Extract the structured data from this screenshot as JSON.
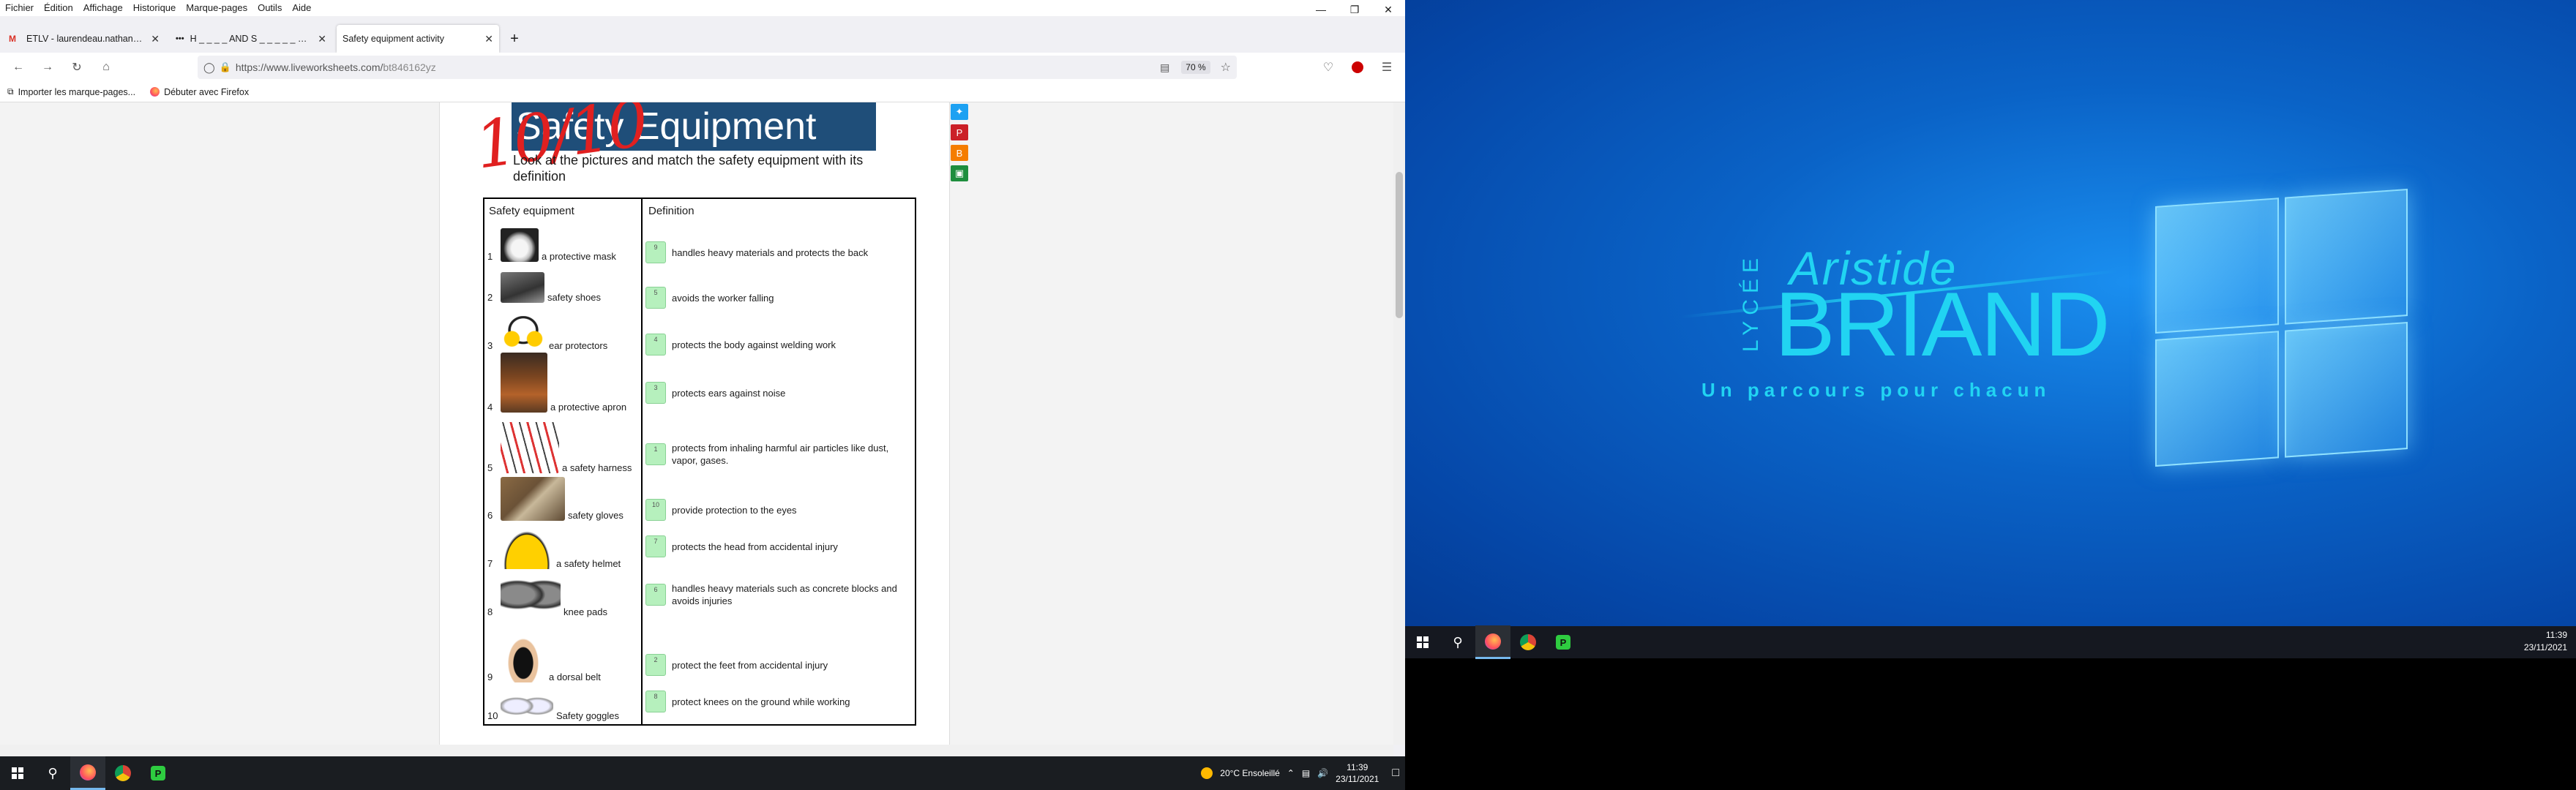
{
  "menubar": {
    "items": [
      "Fichier",
      "Édition",
      "Affichage",
      "Historique",
      "Marque-pages",
      "Outils",
      "Aide"
    ]
  },
  "tabs": [
    {
      "title": "ETLV - laurendeau.nathan@gm",
      "icon": "gmail-icon"
    },
    {
      "title": "H _ _ _ _ AND S _ _ _ _ _ _ | Ma",
      "icon": "dots-icon"
    },
    {
      "title": "Safety equipment activity",
      "icon": "",
      "active": true
    }
  ],
  "nav": {
    "url": "https://www.liveworksheets.com/bt846162yz",
    "url_host": "https://www.liveworksheets.com/",
    "url_path": "bt846162yz",
    "zoom": "70 %"
  },
  "bookmarks": [
    {
      "label": "Importer les marque-pages..."
    },
    {
      "label": "Débuter avec Firefox"
    }
  ],
  "worksheet": {
    "title": "Safety Equipment",
    "score": "10/10",
    "instructions": "Look at the pictures and match the safety equipment with its definition",
    "col1": "Safety equipment",
    "col2": "Definition",
    "items": [
      {
        "num": "1",
        "label": "a protective mask"
      },
      {
        "num": "2",
        "label": "safety shoes"
      },
      {
        "num": "3",
        "label": "ear protectors"
      },
      {
        "num": "4",
        "label": "a protective apron"
      },
      {
        "num": "5",
        "label": "a safety harness"
      },
      {
        "num": "6",
        "label": "safety gloves"
      },
      {
        "num": "7",
        "label": "a safety helmet"
      },
      {
        "num": "8",
        "label": "knee pads"
      },
      {
        "num": "9",
        "label": "a dorsal belt"
      },
      {
        "num": "10",
        "label": "Safety goggles"
      }
    ],
    "definitions": [
      {
        "answer": "9",
        "text": "handles heavy materials and protects the back"
      },
      {
        "answer": "5",
        "text": "avoids the worker falling"
      },
      {
        "answer": "4",
        "text": "protects the body against welding work"
      },
      {
        "answer": "3",
        "text": " protects ears against noise"
      },
      {
        "answer": "1",
        "text": "protects from inhaling harmful air particles like dust, vapor, gases."
      },
      {
        "answer": "10",
        "text": "provide protection to the eyes"
      },
      {
        "answer": "7",
        "text": "protects the head from accidental injury"
      },
      {
        "answer": "6",
        "text": "handles heavy materials such as concrete blocks and avoids injuries"
      },
      {
        "answer": "2",
        "text": "protect the feet from accidental injury"
      },
      {
        "answer": "8",
        "text": "protect knees on the ground while working"
      }
    ]
  },
  "taskbar": {
    "weather": "20°C  Ensoleillé",
    "time": "11:39",
    "date": "23/11/2021"
  },
  "desktop2": {
    "brand_top": "Aristide",
    "brand_main": "BRIAND",
    "brand_vertical": "LYCÉE",
    "tagline": "Un parcours pour chacun",
    "time": "11:39",
    "date": "23/11/2021"
  }
}
